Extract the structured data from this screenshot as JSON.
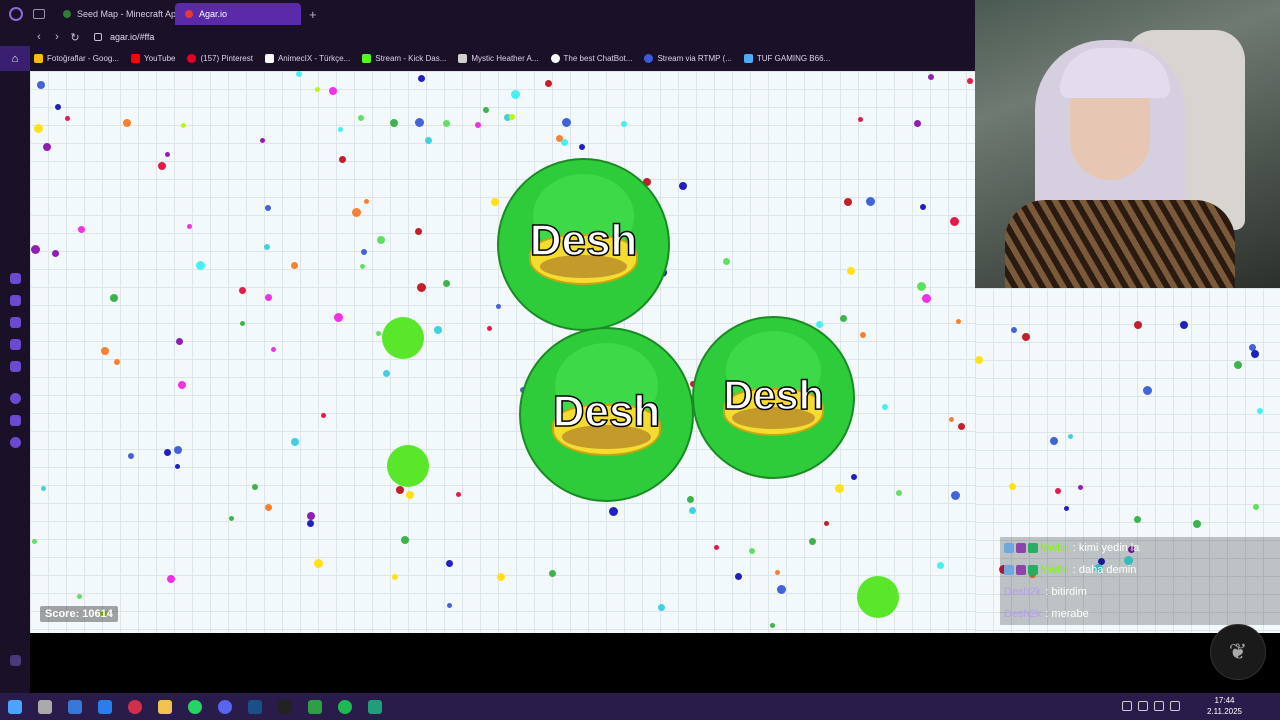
{
  "browser": {
    "tabs": [
      {
        "label": "Seed Map - Minecraft Ap",
        "active": false,
        "color": "#2e7d32"
      },
      {
        "label": "Agar.io",
        "active": true,
        "color": "#e53935"
      }
    ],
    "new_tab": "+",
    "url": "agar.io/#ffa",
    "bookmarks": [
      {
        "label": "Fotoğraflar - Goog...",
        "color": "#fbbc05"
      },
      {
        "label": "YouTube",
        "color": "#ff0000"
      },
      {
        "label": "(157) Pinterest",
        "color": "#e60023"
      },
      {
        "label": "AnimecIX - Türkçe...",
        "color": "#ffffff"
      },
      {
        "label": "Stream - Kick Das...",
        "color": "#53fc18"
      },
      {
        "label": "Mystic Heather A...",
        "color": "#d0d0d0"
      },
      {
        "label": "The best ChatBot...",
        "color": "#ffffff"
      },
      {
        "label": "Stream via RTMP (...",
        "color": "#3b5bdb"
      },
      {
        "label": "TUF GAMING B66...",
        "color": "#4dabf7"
      }
    ]
  },
  "game": {
    "player_name": "Desh",
    "score_label": "Score: 10614",
    "chat": [
      {
        "name": "Mwfin",
        "message": ": kimi yedin la",
        "name_color": "#7cfc00"
      },
      {
        "name": "Mwfin",
        "message": ": daha demin",
        "name_color": "#7cfc00"
      },
      {
        "name": "Desh2k",
        "message": ": bitirdim",
        "name_color": "#b89cf0"
      },
      {
        "name": "Desh2k",
        "message": ": merabe",
        "name_color": "#b89cf0"
      }
    ]
  },
  "taskbar": {
    "time": "17:44",
    "date": "2.11.2025"
  },
  "colors": {
    "chrome_bg": "#1a1028",
    "active_tab": "#5a2aa8",
    "cell_green": "#2ecc3a",
    "taskbar_bg": "#2a1c4a"
  }
}
